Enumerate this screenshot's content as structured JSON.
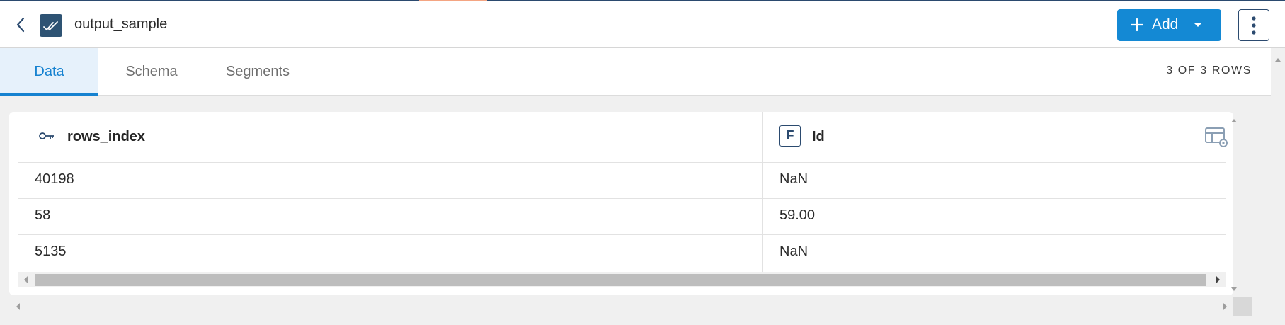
{
  "header": {
    "title": "output_sample",
    "add_label": "Add",
    "icons": {
      "back": "chevron-left-icon",
      "app": "double-check-icon",
      "add": "plus-icon",
      "add_dropdown": "caret-down-icon",
      "more": "vertical-ellipsis-icon"
    }
  },
  "tabs": [
    {
      "label": "Data",
      "active": true
    },
    {
      "label": "Schema",
      "active": false
    },
    {
      "label": "Segments",
      "active": false
    }
  ],
  "rows_count": "3 OF 3 ROWS",
  "table": {
    "columns": [
      {
        "label": "rows_index",
        "icon": "key-icon"
      },
      {
        "label": "Id",
        "icon": "F",
        "icon_name": "field-type-f-icon"
      }
    ],
    "rows": [
      [
        "40198",
        "NaN"
      ],
      [
        "58",
        "59.00"
      ],
      [
        "5135",
        "NaN"
      ]
    ],
    "settings_icon": "table-settings-icon"
  },
  "colors": {
    "accent": "#1489d4",
    "active_tab_bg": "#e6f1fb",
    "brand_dark": "#2b4a6f"
  }
}
